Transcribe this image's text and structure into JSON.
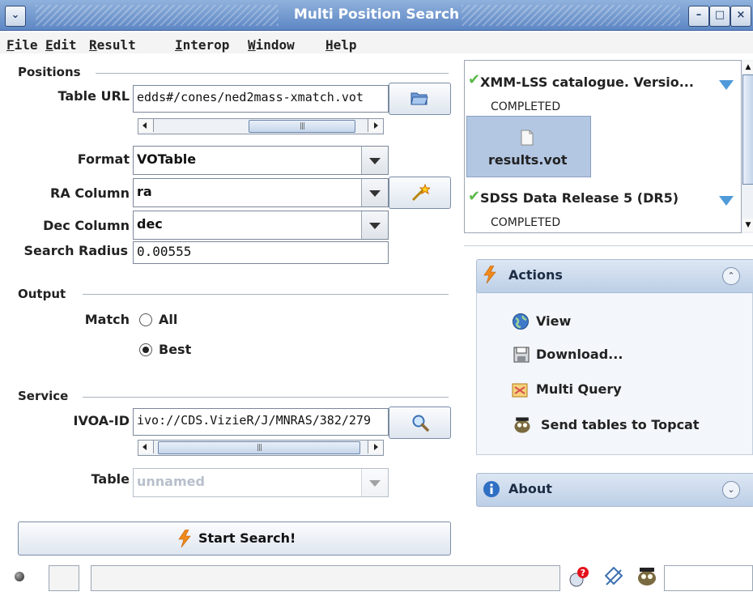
{
  "window": {
    "title": "Multi Position Search"
  },
  "menu": [
    {
      "label": "File",
      "u": "F",
      "rest": "ile"
    },
    {
      "label": "Edit",
      "u": "E",
      "rest": "dit"
    },
    {
      "label": "Result",
      "u": "R",
      "rest": "esult"
    },
    {
      "label": "Interop",
      "u": "I",
      "rest": "nterop"
    },
    {
      "label": "Window",
      "u": "W",
      "rest": "indow"
    },
    {
      "label": "Help",
      "u": "H",
      "rest": "elp"
    }
  ],
  "positions": {
    "section": "Positions",
    "table_url_label": "Table URL",
    "table_url_value": "edds#/cones/ned2mass-xmatch.vot",
    "format_label": "Format",
    "format_value": "VOTable",
    "ra_label": "RA Column",
    "ra_value": "ra",
    "dec_label": "Dec Column",
    "dec_value": "dec",
    "radius_label": "Search Radius",
    "radius_value": "0.00555"
  },
  "output": {
    "section": "Output",
    "match_label": "Match",
    "option_all": "All",
    "option_best": "Best",
    "selected": "Best"
  },
  "service": {
    "section": "Service",
    "ivoa_label": "IVOA-ID",
    "ivoa_value": "ivo://CDS.VizieR/J/MNRAS/382/279",
    "table_label": "Table",
    "table_value": "unnamed"
  },
  "start_button": "Start Search!",
  "jobs": [
    {
      "title": "XMM-LSS catalogue. Versio...",
      "status": "COMPLETED",
      "file": "results.vot"
    },
    {
      "title": "SDSS Data Release 5 (DR5)",
      "status": "COMPLETED"
    }
  ],
  "actions": {
    "title": "Actions",
    "items": [
      "View",
      "Download...",
      "Multi Query",
      "Send tables to Topcat"
    ]
  },
  "about": {
    "title": "About"
  }
}
